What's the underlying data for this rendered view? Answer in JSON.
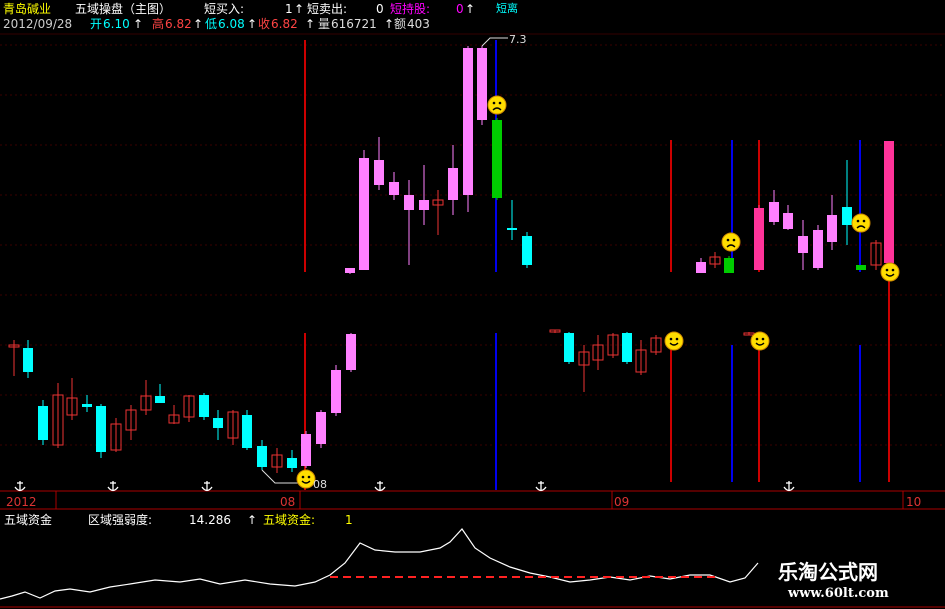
{
  "header": {
    "stock_name": "青岛碱业",
    "indicator_name": "五域操盘（主图）",
    "short_buy_label": "短买入:",
    "short_buy_value": "1",
    "short_sell_label": "短卖出:",
    "short_sell_value": "0",
    "short_hold_label": "短持股:",
    "short_hold_value": "0",
    "short_extra_label": "短离",
    "arrow": "↑"
  },
  "quote": {
    "date": "2012/09/28",
    "open_label": "开",
    "open": "6.10",
    "high_label": "高",
    "high": "6.82",
    "low_label": "低",
    "low": "6.08",
    "close_label": "收",
    "close": "6.82",
    "volume_label": "量",
    "volume": "616721",
    "amount_label": "额",
    "amount": "403"
  },
  "price_annotations": {
    "high_marker": "7.3",
    "low_marker": "08"
  },
  "timeline": {
    "labels": [
      "2012",
      "08",
      "09",
      "10"
    ]
  },
  "sub_panel": {
    "title": "五域资金",
    "strength_label": "区域强弱度:",
    "strength_value": "14.286",
    "arrow": "↑",
    "fund_label": "五域资金:",
    "fund_value": "1"
  },
  "watermark": {
    "line1": "乐淘公式网",
    "line2": "www.60lt.com"
  },
  "colors": {
    "up_magenta": "#ff80ff",
    "down_cyan": "#00ffff",
    "hot_pink": "#ff3399",
    "green_bar": "#00cc00",
    "red_line": "#cc0000",
    "blue_line": "#0000ee",
    "yellow_text": "#ffff00",
    "grid_dark": "#3a0000"
  },
  "icons": [
    "smiley-face-icon",
    "sad-face-icon",
    "anchor-icon"
  ]
}
